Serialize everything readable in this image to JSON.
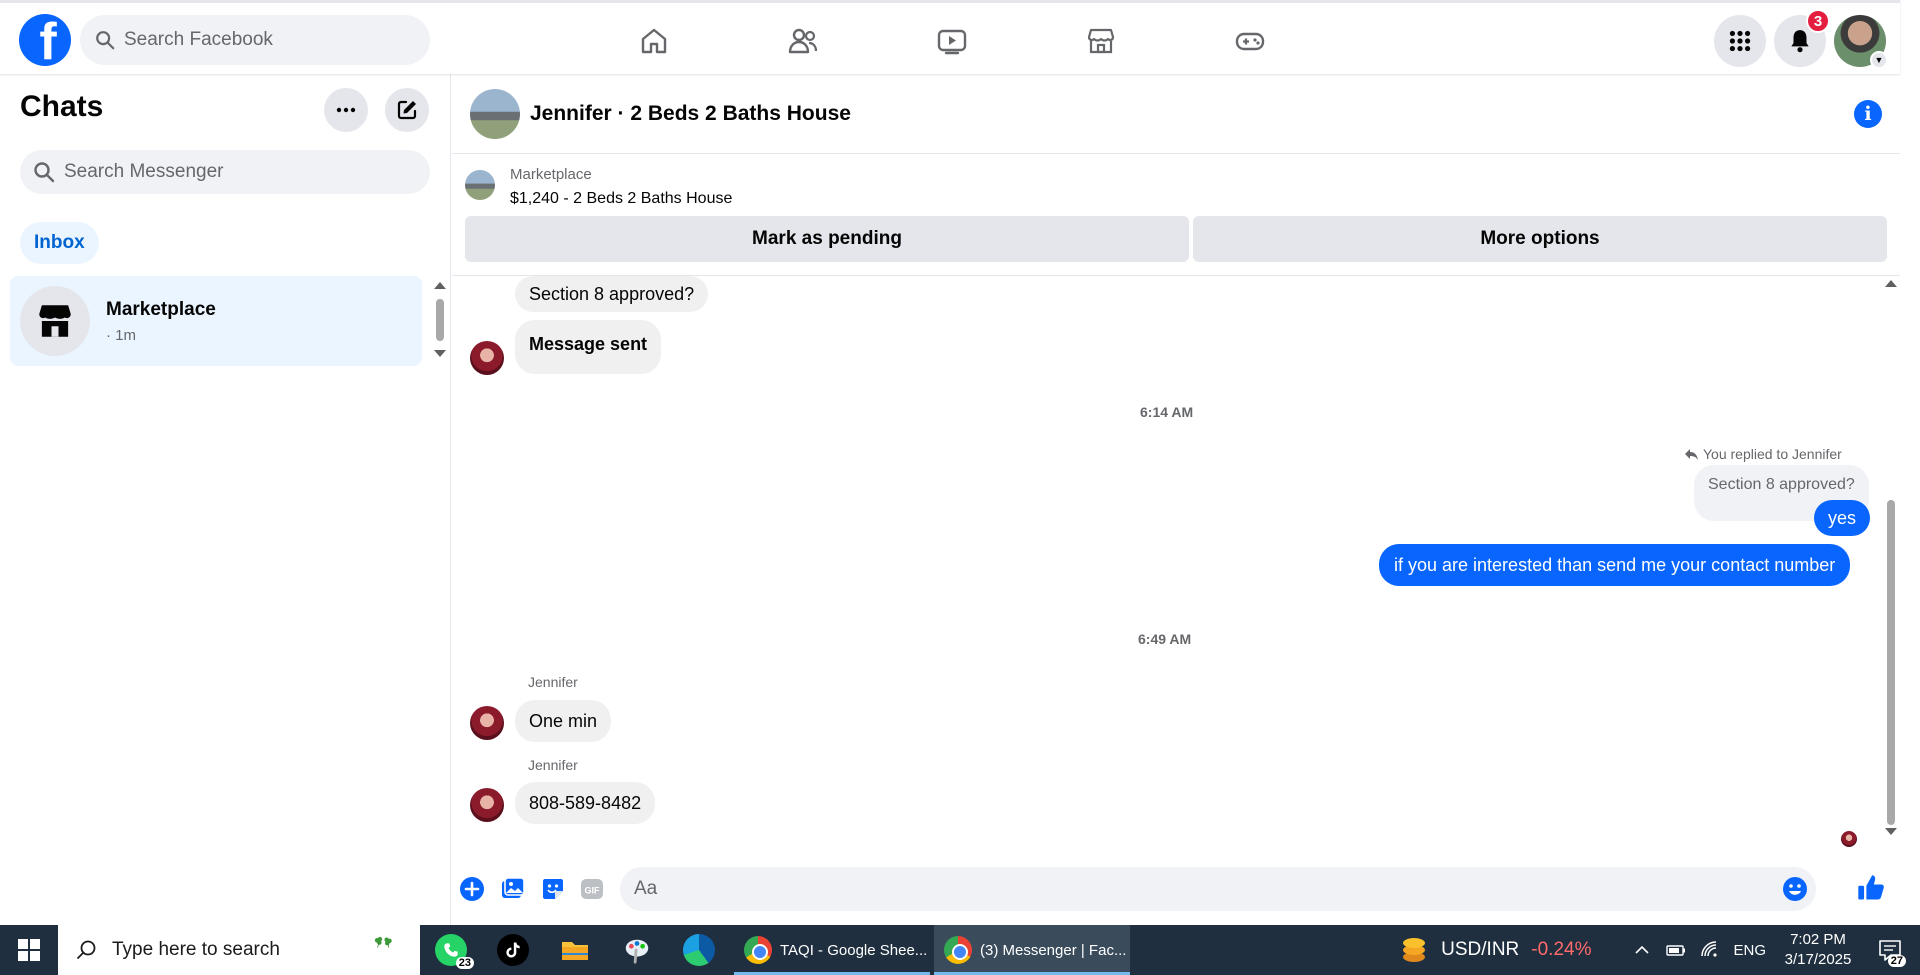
{
  "topbar": {
    "logo_letter": "f",
    "search_placeholder": "Search Facebook",
    "nav": [
      "home-icon",
      "friends-icon",
      "watch-icon",
      "marketplace-icon",
      "gaming-icon"
    ],
    "notification_count": "3",
    "accent_color": "#0866ff"
  },
  "sidebar": {
    "title": "Chats",
    "search_placeholder": "Search Messenger",
    "filter_label": "Inbox",
    "chats": [
      {
        "name": "Marketplace",
        "meta": "· 1m",
        "icon": "store-icon"
      }
    ]
  },
  "conversation": {
    "title": "Jennifer · 2 Beds 2 Baths House",
    "marketplace_label": "Marketplace",
    "listing": "$1,240 - 2 Beds 2 Baths House",
    "pending_button": "Mark as pending",
    "more_button": "More options",
    "messages": {
      "m1": "Section 8 approved?",
      "m2": "Message sent",
      "time1": "6:14 AM",
      "reply_note": "You replied to Jennifer",
      "quoted": "Section 8 approved?",
      "out1": "yes",
      "out2": "if you are interested than send me your contact number",
      "time2": "6:49 AM",
      "sender": "Jennifer",
      "in1": "One min",
      "in2": "808-589-8482"
    },
    "composer_placeholder": "Aa"
  },
  "taskbar": {
    "search_placeholder": "Type here to search",
    "whatsapp_count": "23",
    "windows": [
      {
        "label": "TAQI - Google Shee..."
      },
      {
        "label": "(3) Messenger | Fac..."
      }
    ],
    "fx_pair": "USD/INR",
    "fx_change": "-0.24%",
    "language": "ENG",
    "time": "7:02 PM",
    "date": "3/17/2025",
    "notifications": "27"
  }
}
